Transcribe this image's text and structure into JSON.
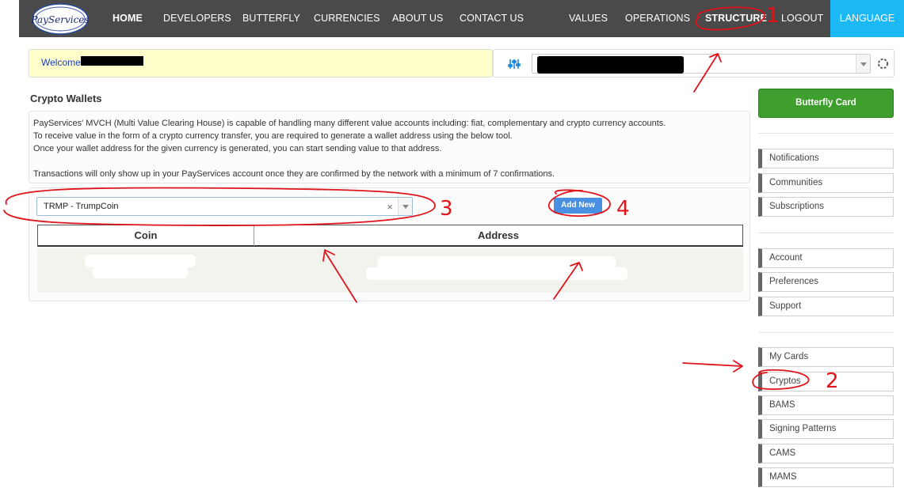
{
  "nav": {
    "logo_text": "PayServices",
    "items": [
      "HOME",
      "DEVELOPERS",
      "BUTTERFLY",
      "CURRENCIES",
      "ABOUT US",
      "CONTACT US",
      "VALUES",
      "OPERATIONS",
      "STRUCTURE",
      "LOGOUT"
    ],
    "language": "LANGUAGE"
  },
  "welcome": {
    "label": "Welcome"
  },
  "page": {
    "title": "Crypto Wallets",
    "info_lines": [
      "PayServices' MVCH (Multi Value Clearing House) is capable of handling many different value accounts including: fiat, complementary and crypto currency accounts.",
      "To receive value in the form of a crypto currency transfer, you are required to generate a wallet address using the below tool.",
      "Once your wallet address for the given currency is generated, you can start sending value to that address.",
      "Transactions will only show up in your PayServices account once they are confirmed by the network with a minimum of 7 confirmations."
    ]
  },
  "tool": {
    "selected_coin": "TRMP - TrumpCoin",
    "clear_symbol": "×",
    "add_button": "Add New",
    "columns": [
      "Coin",
      "Address"
    ]
  },
  "sidebar": {
    "butterfly_card": "Butterfly Card",
    "group1": [
      "Notifications",
      "Communities",
      "Subscriptions"
    ],
    "group2": [
      "Account",
      "Preferences",
      "Support"
    ],
    "group3": [
      "My Cards",
      "Cryptos",
      "BAMS",
      "Signing Patterns",
      "CAMS",
      "MAMS"
    ]
  },
  "annotations": [
    "1",
    "2",
    "3",
    "4"
  ],
  "colors": {
    "navbar": "#4a4a4a",
    "language": "#1ab8f5",
    "welcome_bg": "#ffffcc",
    "green_button": "#3e9e2e",
    "add_button": "#4a90e2",
    "annotation_red": "#e0141b"
  }
}
